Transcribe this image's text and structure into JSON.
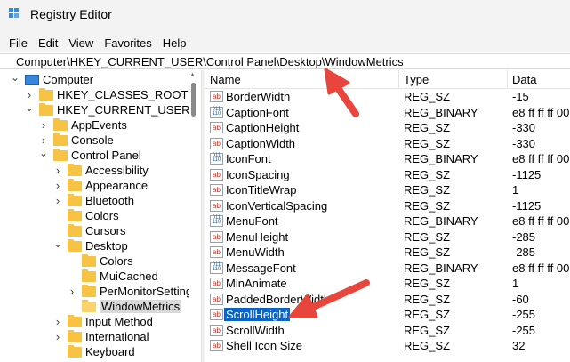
{
  "window": {
    "title": "Registry Editor"
  },
  "menu": [
    "File",
    "Edit",
    "View",
    "Favorites",
    "Help"
  ],
  "address": "Computer\\HKEY_CURRENT_USER\\Control Panel\\Desktop\\WindowMetrics",
  "tree": [
    {
      "label": "Computer",
      "depth": 0,
      "chev": "down",
      "icon": "computer"
    },
    {
      "label": "HKEY_CLASSES_ROOT",
      "depth": 1,
      "chev": "right",
      "icon": "folder"
    },
    {
      "label": "HKEY_CURRENT_USER",
      "depth": 1,
      "chev": "down",
      "icon": "folder"
    },
    {
      "label": "AppEvents",
      "depth": 2,
      "chev": "right",
      "icon": "folder"
    },
    {
      "label": "Console",
      "depth": 2,
      "chev": "right",
      "icon": "folder"
    },
    {
      "label": "Control Panel",
      "depth": 2,
      "chev": "down",
      "icon": "folder"
    },
    {
      "label": "Accessibility",
      "depth": 3,
      "chev": "right",
      "icon": "folder"
    },
    {
      "label": "Appearance",
      "depth": 3,
      "chev": "right",
      "icon": "folder"
    },
    {
      "label": "Bluetooth",
      "depth": 3,
      "chev": "right",
      "icon": "folder"
    },
    {
      "label": "Colors",
      "depth": 3,
      "chev": "none",
      "icon": "folder"
    },
    {
      "label": "Cursors",
      "depth": 3,
      "chev": "none",
      "icon": "folder"
    },
    {
      "label": "Desktop",
      "depth": 3,
      "chev": "down",
      "icon": "folder"
    },
    {
      "label": "Colors",
      "depth": 4,
      "chev": "none",
      "icon": "folder"
    },
    {
      "label": "MuiCached",
      "depth": 4,
      "chev": "none",
      "icon": "folder"
    },
    {
      "label": "PerMonitorSettings",
      "depth": 4,
      "chev": "right",
      "icon": "folder"
    },
    {
      "label": "WindowMetrics",
      "depth": 4,
      "chev": "none",
      "icon": "folder-open",
      "selected": true
    },
    {
      "label": "Input Method",
      "depth": 3,
      "chev": "right",
      "icon": "folder"
    },
    {
      "label": "International",
      "depth": 3,
      "chev": "right",
      "icon": "folder"
    },
    {
      "label": "Keyboard",
      "depth": 3,
      "chev": "none",
      "icon": "folder"
    }
  ],
  "columns": {
    "name": "Name",
    "type": "Type",
    "data": "Data"
  },
  "values": [
    {
      "name": "BorderWidth",
      "type": "REG_SZ",
      "data": "-15",
      "kind": "sz"
    },
    {
      "name": "CaptionFont",
      "type": "REG_BINARY",
      "data": "e8 ff ff ff 00",
      "kind": "bin"
    },
    {
      "name": "CaptionHeight",
      "type": "REG_SZ",
      "data": "-330",
      "kind": "sz"
    },
    {
      "name": "CaptionWidth",
      "type": "REG_SZ",
      "data": "-330",
      "kind": "sz"
    },
    {
      "name": "IconFont",
      "type": "REG_BINARY",
      "data": "e8 ff ff ff 00",
      "kind": "bin"
    },
    {
      "name": "IconSpacing",
      "type": "REG_SZ",
      "data": "-1125",
      "kind": "sz"
    },
    {
      "name": "IconTitleWrap",
      "type": "REG_SZ",
      "data": "1",
      "kind": "sz"
    },
    {
      "name": "IconVerticalSpacing",
      "type": "REG_SZ",
      "data": "-1125",
      "kind": "sz"
    },
    {
      "name": "MenuFont",
      "type": "REG_BINARY",
      "data": "e8 ff ff ff 00",
      "kind": "bin"
    },
    {
      "name": "MenuHeight",
      "type": "REG_SZ",
      "data": "-285",
      "kind": "sz"
    },
    {
      "name": "MenuWidth",
      "type": "REG_SZ",
      "data": "-285",
      "kind": "sz"
    },
    {
      "name": "MessageFont",
      "type": "REG_BINARY",
      "data": "e8 ff ff ff 00",
      "kind": "bin"
    },
    {
      "name": "MinAnimate",
      "type": "REG_SZ",
      "data": "1",
      "kind": "sz"
    },
    {
      "name": "PaddedBorderWidth",
      "type": "REG_SZ",
      "data": "-60",
      "kind": "sz"
    },
    {
      "name": "ScrollHeight",
      "type": "REG_SZ",
      "data": "-255",
      "kind": "sz",
      "selected": true
    },
    {
      "name": "ScrollWidth",
      "type": "REG_SZ",
      "data": "-255",
      "kind": "sz"
    },
    {
      "name": "Shell Icon Size",
      "type": "REG_SZ",
      "data": "32",
      "kind": "sz"
    }
  ],
  "colors": {
    "selection": "#0a64c8",
    "annotation_arrow": "#e8453c",
    "folder": "#f6c344"
  }
}
